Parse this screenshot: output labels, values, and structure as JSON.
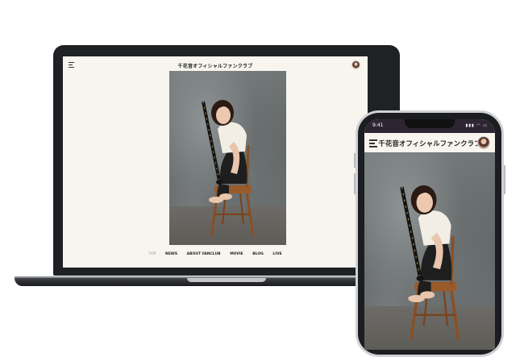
{
  "site": {
    "title": "千花音オフィシャルファンクラブ"
  },
  "desktop": {
    "nav": [
      "TOP",
      "NEWS",
      "ABOUT FANCLUB",
      "MOVIE",
      "BLOG",
      "LIVE"
    ],
    "active_nav": "TOP"
  },
  "mobile": {
    "status_time": "9:41",
    "status_icons": "▮▮▮ ◠ ▭"
  }
}
